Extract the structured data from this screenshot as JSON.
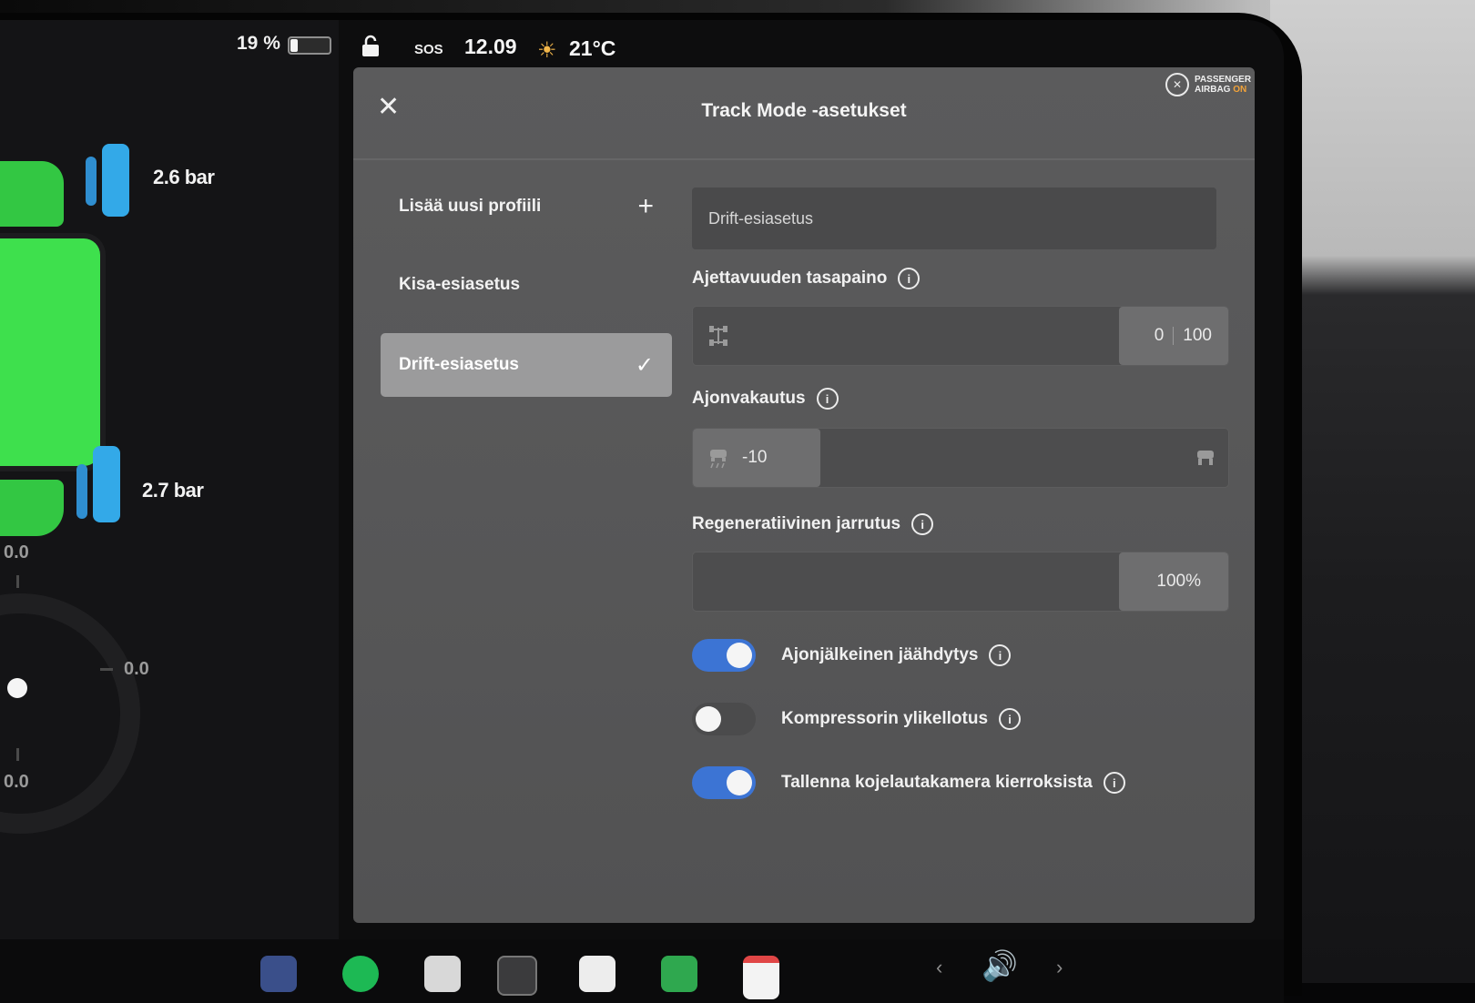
{
  "status_bar": {
    "battery_percent_label": "19 %",
    "battery_level": 0.19,
    "sos_label": "SOS",
    "time": "12.09",
    "temperature": "21°C",
    "airbag_line1": "PASSENGER",
    "airbag_line2": "AIRBAG",
    "airbag_state": "ON",
    "airbag_state_color": "#f2a33a"
  },
  "car_panel": {
    "front_tire_pressure": "2.6 bar",
    "rear_tire_pressure": "2.7 bar",
    "gauge_top": "0.0",
    "gauge_right": "0.0",
    "gauge_bottom": "0.0",
    "body_color": "#3ee04d",
    "tire_color": "#33a9e8"
  },
  "dialog": {
    "title": "Track Mode -asetukset",
    "close_icon": "close-icon",
    "profiles": [
      {
        "label": "Lisää uusi profiili",
        "icon": "+",
        "selected": false
      },
      {
        "label": "Kisa-esiasetus",
        "icon": "",
        "selected": false
      },
      {
        "label": "Drift-esiasetus",
        "icon": "✓",
        "selected": true
      }
    ],
    "profile_name_value": "Drift-esiasetus",
    "handling_balance": {
      "label": "Ajettavuuden tasapaino",
      "front_value": "0",
      "rear_value": "100"
    },
    "stability_assist": {
      "label": "Ajonvakautus",
      "value": "-10"
    },
    "regen_braking": {
      "label": "Regeneratiivinen jarrutus",
      "value": "100%",
      "level": 1.0
    },
    "toggles": [
      {
        "label": "Ajonjälkeinen jäähdytys",
        "on": true
      },
      {
        "label": "Kompressorin ylikellotus",
        "on": false
      },
      {
        "label": "Tallenna kojelautakamera kierroksista",
        "on": true
      }
    ],
    "accent_color": "#3c74d4"
  }
}
